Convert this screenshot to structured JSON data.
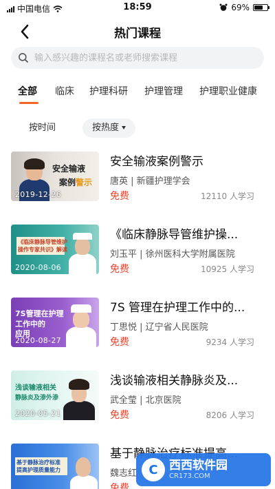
{
  "status_bar": {
    "carrier": "中国电信",
    "time": "18:59",
    "battery": "69%",
    "battery_level": 0.69
  },
  "nav": {
    "title": "热门课程"
  },
  "search": {
    "placeholder": "输入感兴趣的课程名或老师搜索课程"
  },
  "tabs": [
    {
      "label": "全部"
    },
    {
      "label": "临床"
    },
    {
      "label": "护理科研"
    },
    {
      "label": "护理管理"
    },
    {
      "label": "护理职业健康"
    }
  ],
  "sort": {
    "by_time": "按时间",
    "by_popularity": "按热度"
  },
  "courses": [
    {
      "title": "安全输液案例警示",
      "teacher": "唐英",
      "org": "新疆护理学会",
      "price": "免费",
      "learners": "12110 人学习",
      "date": "2019-12-26",
      "thumb_line1": "安全输液",
      "thumb_line2": "案例",
      "thumb_line2_accent": "警示"
    },
    {
      "title": "《临床静脉导管维护操...",
      "teacher": "刘玉平",
      "org": "徐州医科大学附属医院",
      "price": "免费",
      "learners": "10925 人学习",
      "date": "2020-08-06",
      "thumb_line1": "《临床静脉导管维护",
      "thumb_line2": "操作专家共识》解读"
    },
    {
      "title": "7S 管理在护理工作中的...",
      "teacher": "丁思悦",
      "org": "辽宁省人民医院",
      "price": "免费",
      "learners": "9234 人学习",
      "date": "2020-08-27",
      "thumb_line1": "7S管理在护理",
      "thumb_line2": "工作中的",
      "thumb_line3": "应用"
    },
    {
      "title": "浅谈输液相关静脉炎及...",
      "teacher": "武全莹",
      "org": "北京医院",
      "price": "免费",
      "learners": "8206 人学习",
      "date": "2020-05-21",
      "thumb_line1": "浅谈输液相关",
      "thumb_line2": "静脉炎及渗外渗"
    },
    {
      "title": "基于静脉治疗标准提高...",
      "teacher": "魏志红",
      "org": "",
      "price": "免费",
      "learners": "",
      "date": "",
      "thumb_line1": "基于静脉治疗标准",
      "thumb_line2": "提高护理质量能力"
    }
  ],
  "watermark": {
    "logo": "C",
    "brand": "西西软件园",
    "site": "CR173.COM"
  },
  "colors": {
    "accent": "#f26522",
    "price": "#e8452c"
  }
}
